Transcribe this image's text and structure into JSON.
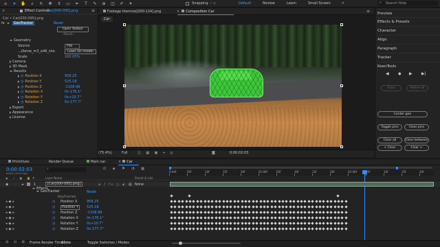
{
  "menubar": {
    "tools": [
      "home-icon",
      "selection-icon",
      "hand-icon",
      "zoom-icon",
      "orbit-icon",
      "pan-icon",
      "dolly-icon",
      "rectangle-icon",
      "pen-icon",
      "type-icon",
      "brush-icon",
      "clone-icon",
      "eraser-icon",
      "roto-icon",
      "puppet-icon"
    ],
    "snapping_label": "Snapping",
    "workspaces": [
      "Default",
      "Review",
      "Learn",
      "Small Screen"
    ],
    "search_placeholder": "Search Help"
  },
  "effect_controls": {
    "tab_label": "Effect Controls",
    "tab_file": "Car[000-095].png",
    "comp_path": "Car • Car[000-095].png",
    "effect_name": "GeoTracker",
    "reset_label": "Reset",
    "open_toolbar_label": "Open Toolbar",
    "about_label": "About...",
    "rows": [
      {
        "label": "Geometry",
        "indent": 1,
        "open": true
      },
      {
        "label": "Source",
        "indent": 2,
        "value": "File"
      },
      {
        "label": "...l/bmw_m3_e46_sho",
        "indent": 2,
        "value": "Load 3D model"
      },
      {
        "label": "Scale",
        "indent": 2,
        "value": "100.00%"
      },
      {
        "label": "Camera",
        "indent": 1
      },
      {
        "label": "3D Mask",
        "indent": 1
      },
      {
        "label": "Results",
        "indent": 1,
        "open": true
      },
      {
        "label": "Position X",
        "indent": 2,
        "value": "958.25"
      },
      {
        "label": "Position Y",
        "indent": 2,
        "value": "525.18"
      },
      {
        "label": "Position Z",
        "indent": 2,
        "value": "-1108.99"
      },
      {
        "label": "Rotation X",
        "indent": 2,
        "value": "0x-176.1°"
      },
      {
        "label": "Rotation Y",
        "indent": 2,
        "value": "0x+10.7°"
      },
      {
        "label": "Rotation Z",
        "indent": 2,
        "value": "0x-177.7°"
      },
      {
        "label": "Export",
        "indent": 1
      },
      {
        "label": "Appearance",
        "indent": 1
      },
      {
        "label": "License",
        "indent": 1
      }
    ]
  },
  "footage_tab": "Footage thermos[000-124].png",
  "composition_tab": "Composition Car",
  "comp_breadcrumb": "Car",
  "viewer_bottom": {
    "zoom": "(75.4%)",
    "resolution": "Full",
    "timecode": "0:00:02:03"
  },
  "right_panels": [
    "Preview",
    "Effects & Presets",
    "Character",
    "Align",
    "Paragraph",
    "Tracker",
    "KeenTools"
  ],
  "keentools": {
    "buttons_row1": [
      "Track",
      "Refine all"
    ],
    "center_geo": "Center geo",
    "toggle_pins": "Toggle pins",
    "clear_pins": "Clear pins",
    "clear_all": "Clear all",
    "clear_between": "Clear between",
    "clear_left": "< Clear",
    "clear_right": "Clear >"
  },
  "timeline": {
    "tabs": [
      "Primitives",
      "Render Queue",
      "Main car",
      "Car"
    ],
    "active_tab": "Car",
    "timecode": "0:00:02:03",
    "frame_info": "00051 (25.00 fps)",
    "search_placeholder": "",
    "col_layer_name": "Layer Name",
    "col_parent": "Parent & Link",
    "layer_number": "1",
    "layer_name": "[Car[000-095].png]",
    "parent_value": "None",
    "effects_label": "Effects",
    "geotracker_label": "GeoTracker",
    "reset_label": "Reset",
    "keyframes_label": "Keyframes",
    "props": [
      {
        "label": "Position X",
        "value": "958.25"
      },
      {
        "label": "Position Y",
        "value": "525.18"
      },
      {
        "label": "Position Z",
        "value": "-1108.99"
      },
      {
        "label": "Rotation X",
        "value": "0x-176.1°"
      },
      {
        "label": "Rotation Y",
        "value": "0x+10.7°"
      },
      {
        "label": "Rotation Z",
        "value": "0x-177.7°"
      }
    ],
    "ruler_labels": [
      "0:00f",
      "05f",
      "10f",
      "15f",
      "20f",
      "01:00f",
      "05f",
      "10f",
      "15f",
      "20f",
      "02:00f",
      "05f",
      "10f",
      "15f",
      "20f"
    ],
    "footer_left": "Frame Render Time",
    "footer_time": "16ms",
    "footer_toggle": "Toggle Switches / Modes"
  },
  "colors": {
    "accent_blue": "#2d8cff",
    "layer_bar": "#4e6c59",
    "mask_green": "#3fd23a",
    "track_green": "#7fb489"
  }
}
